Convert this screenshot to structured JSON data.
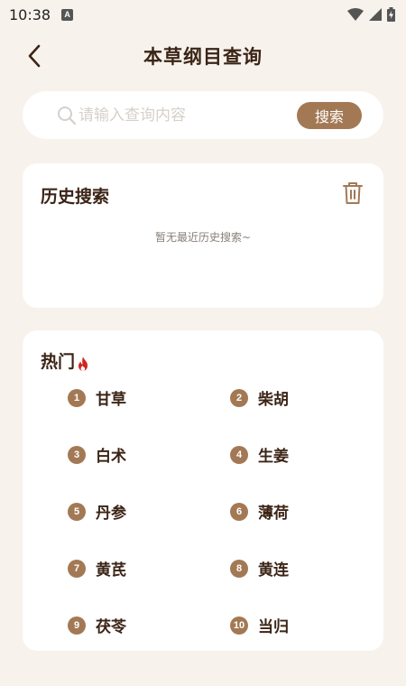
{
  "status_bar": {
    "time": "10:38"
  },
  "header": {
    "title": "本草纲目查询"
  },
  "search": {
    "placeholder": "请输入查询内容",
    "button_label": "搜索"
  },
  "history": {
    "title": "历史搜索",
    "empty_text": "暂无最近历史搜索~"
  },
  "hot": {
    "title": "热门",
    "items": [
      {
        "rank": "1",
        "name": "甘草"
      },
      {
        "rank": "2",
        "name": "柴胡"
      },
      {
        "rank": "3",
        "name": "白术"
      },
      {
        "rank": "4",
        "name": "生姜"
      },
      {
        "rank": "5",
        "name": "丹参"
      },
      {
        "rank": "6",
        "name": "薄荷"
      },
      {
        "rank": "7",
        "name": "黄芪"
      },
      {
        "rank": "8",
        "name": "黄连"
      },
      {
        "rank": "9",
        "name": "茯苓"
      },
      {
        "rank": "10",
        "name": "当归"
      }
    ]
  },
  "colors": {
    "accent": "#a37955",
    "background": "#f7f2ec",
    "text": "#3b2416",
    "fire": "#d0261e"
  },
  "icons": [
    "back-arrow-icon",
    "search-icon",
    "trash-icon",
    "fire-icon",
    "wifi-icon",
    "signal-icon",
    "battery-icon",
    "notification-icon"
  ]
}
